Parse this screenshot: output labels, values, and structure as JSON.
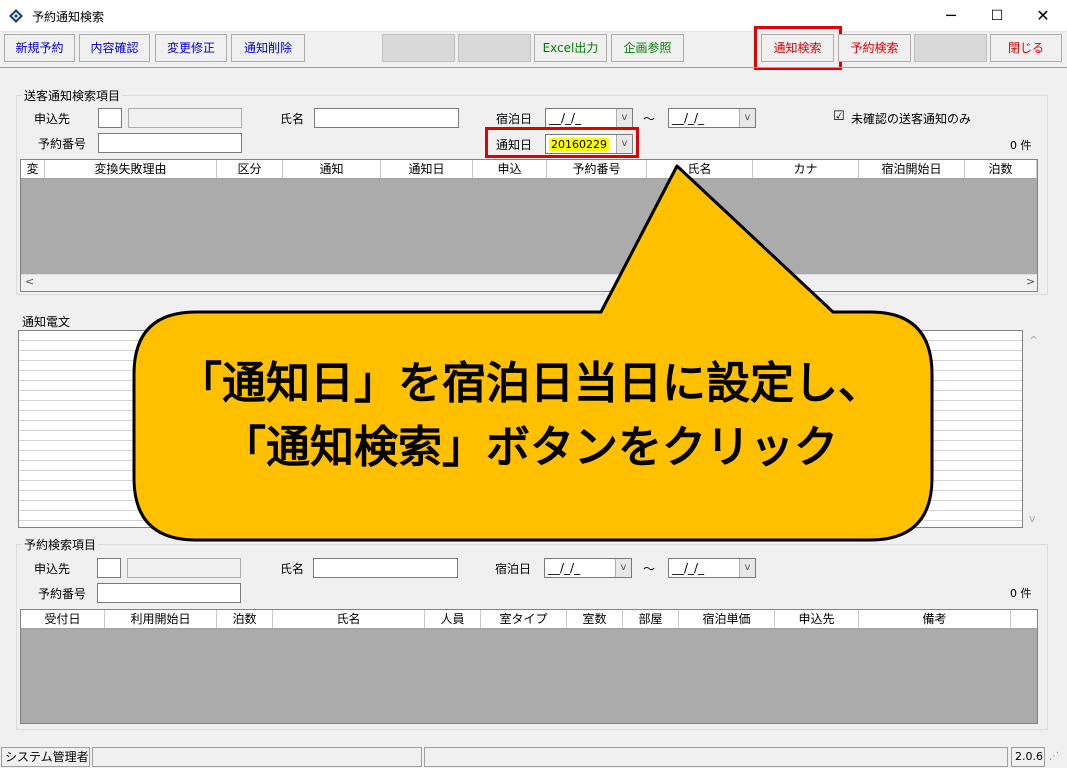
{
  "window": {
    "title": "予約通知検索",
    "minimize": "─",
    "maximize": "☐",
    "close": "✕"
  },
  "toolbar": {
    "new_reservation": "新規予約",
    "content_check": "内容確認",
    "modify": "変更修正",
    "delete_notice": "通知削除",
    "excel_export": "Excel出力",
    "plan_ref": "企画参照",
    "notice_search": "通知検索",
    "reservation_search": "予約検索",
    "close": "閉じる"
  },
  "notice_search_group": {
    "title": "送客通知検索項目",
    "applicant_label": "申込先",
    "name_label": "氏名",
    "stay_date_label": "宿泊日",
    "stay_date_from": "__/_/_",
    "range_sep": "～",
    "stay_date_to": "__/_/_",
    "unconfirmed_checkbox": "未確認の送客通知のみ",
    "checkbox_mark": "☑",
    "reservation_no_label": "予約番号",
    "notice_date_label": "通知日",
    "notice_date_value": "20160229",
    "count": "0 件",
    "columns": [
      "変",
      "変換失敗理由",
      "区分",
      "通知",
      "通知日",
      "申込",
      "予約番号",
      "氏名",
      "カナ",
      "宿泊開始日",
      "泊数"
    ]
  },
  "notice_text": {
    "label": "通知電文"
  },
  "reservation_search_group": {
    "title": "予約検索項目",
    "applicant_label": "申込先",
    "name_label": "氏名",
    "stay_date_label": "宿泊日",
    "stay_date_from": "__/_/_",
    "range_sep": "～",
    "stay_date_to": "__/_/_",
    "reservation_no_label": "予約番号",
    "count": "0 件",
    "columns": [
      "受付日",
      "利用開始日",
      "泊数",
      "氏名",
      "人員",
      "室タイプ",
      "室数",
      "部屋",
      "宿泊単価",
      "申込先",
      "備考"
    ]
  },
  "status_bar": {
    "user": "システム管理者",
    "version": "2.0.6"
  },
  "callout": {
    "line1": "「通知日」を宿泊日当日に設定し、",
    "line2": "「通知検索」ボタンをクリック",
    "fill_color": "#ffc000"
  },
  "scroll": {
    "left": "<",
    "right": ">",
    "up": "^",
    "down": "v"
  },
  "colors": {
    "highlight": "#e00000",
    "notice_date_bg": "#ffff00",
    "link_blue": "#0000cc"
  }
}
